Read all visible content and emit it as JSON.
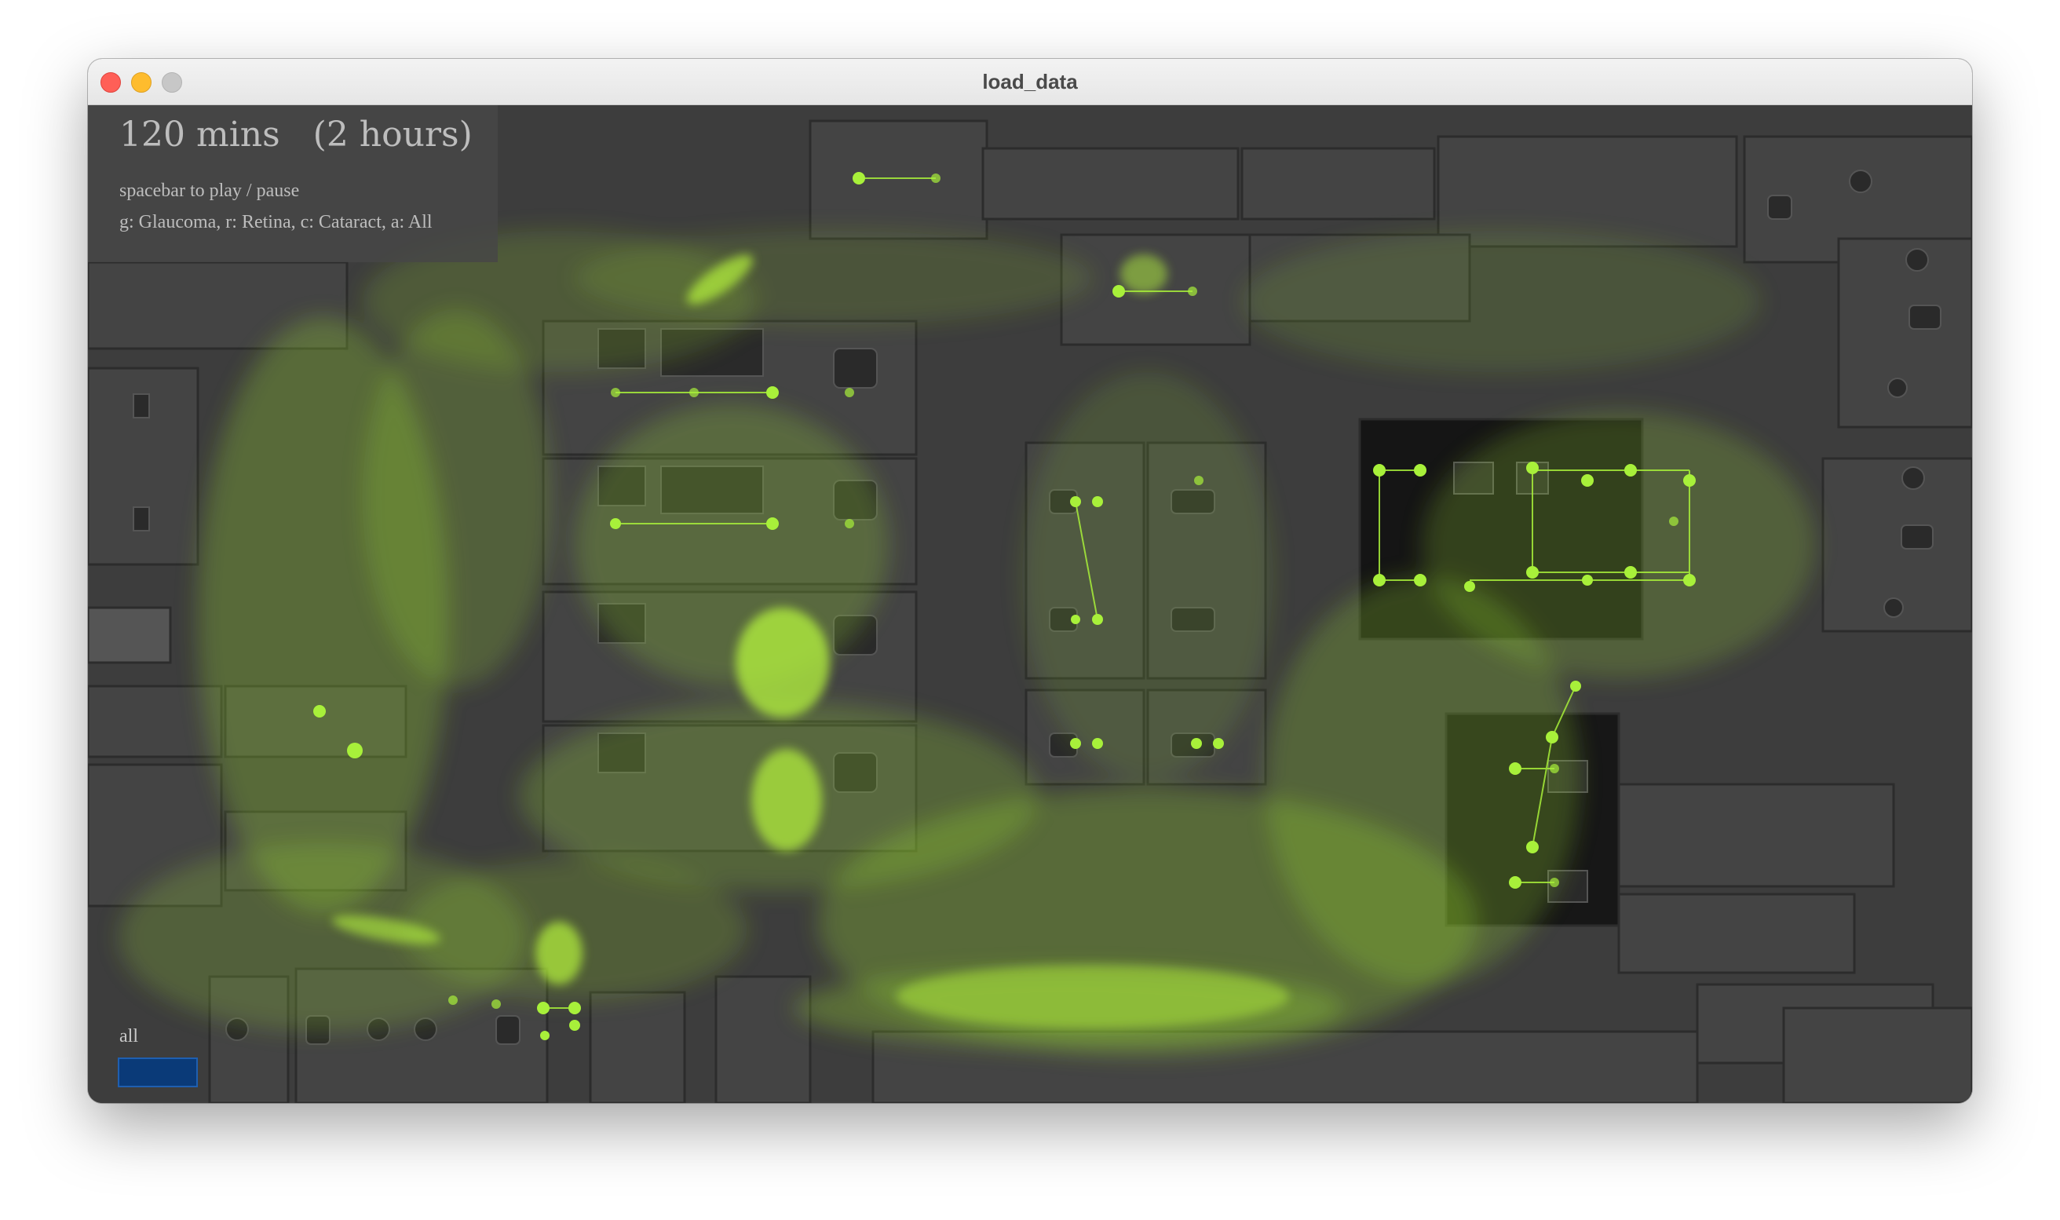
{
  "window": {
    "title": "load_data"
  },
  "hud": {
    "time": "120 mins",
    "duration": "(2 hours)",
    "play_hint": "spacebar to play / pause",
    "filter_hint": "g: Glaucoma, r: Retina, c: Cataract, a: All"
  },
  "filter": {
    "label": "all",
    "color": "#0a3a78"
  },
  "colors": {
    "trail": "#9ee02f",
    "node": "#a8f03a",
    "floor": "#3d3d3d"
  },
  "icons": [
    "close-icon",
    "minimize-icon",
    "maximize-icon"
  ]
}
